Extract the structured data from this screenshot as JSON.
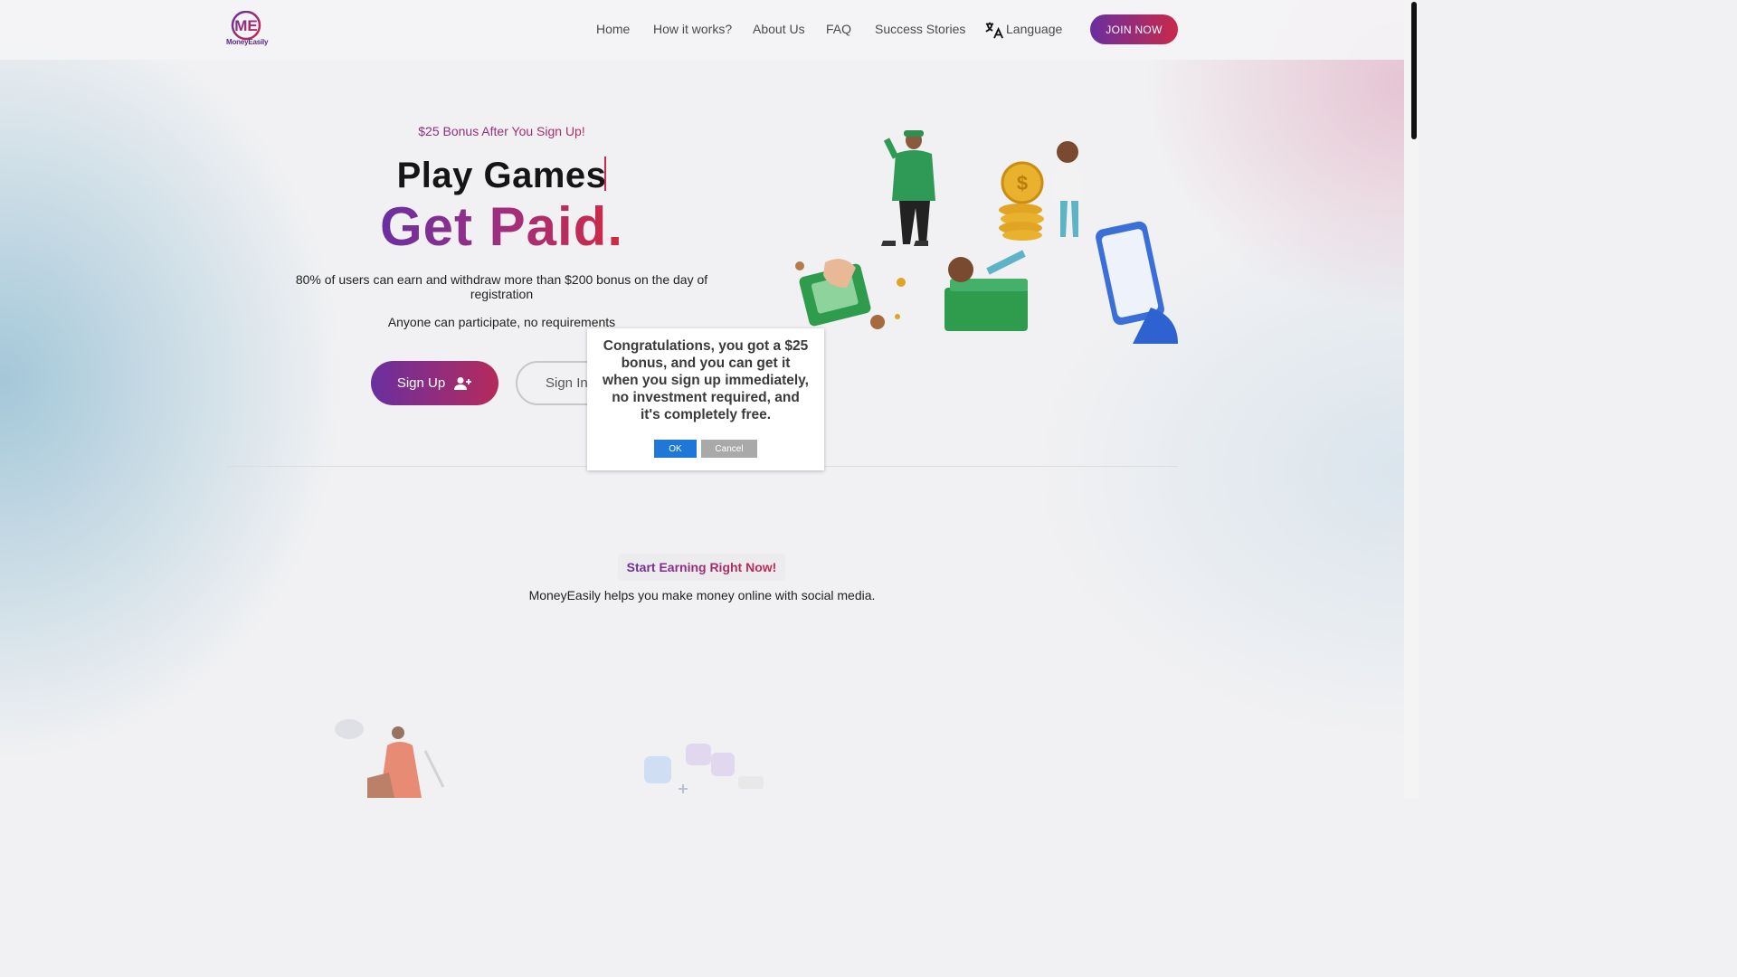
{
  "header": {
    "logo_text": "MoneyEasily",
    "logo_monogram": "ME",
    "nav": [
      {
        "label": "Home"
      },
      {
        "label": "How it works?"
      },
      {
        "label": "About Us"
      },
      {
        "label": "FAQ"
      },
      {
        "label": "Success Stories"
      },
      {
        "label": "Language"
      }
    ],
    "join_label": "JOIN NOW"
  },
  "hero": {
    "bonus_tag": "$25 Bonus After You Sign Up!",
    "headline_line1": "Play Games",
    "headline_line2": "Get Paid.",
    "description": "80% of users can earn and withdraw more than $200 bonus on the day of registration",
    "note": "Anyone can participate, no requirements",
    "signup_label": "Sign Up",
    "signin_label": "Sign In"
  },
  "section": {
    "pill": "Start Earning Right Now!",
    "subtitle": "MoneyEasily helps you make money online with social media."
  },
  "dialog": {
    "message": "Congratulations, you got a $25 bonus, and you can get it when you sign up immediately, no investment required, and it's completely free.",
    "ok_label": "OK",
    "cancel_label": "Cancel"
  },
  "colors": {
    "brand_purple": "#6a2fa0",
    "brand_red": "#c9294a",
    "dialog_ok": "#1f77d8"
  },
  "icons": [
    "translate-icon",
    "user-plus-icon"
  ]
}
